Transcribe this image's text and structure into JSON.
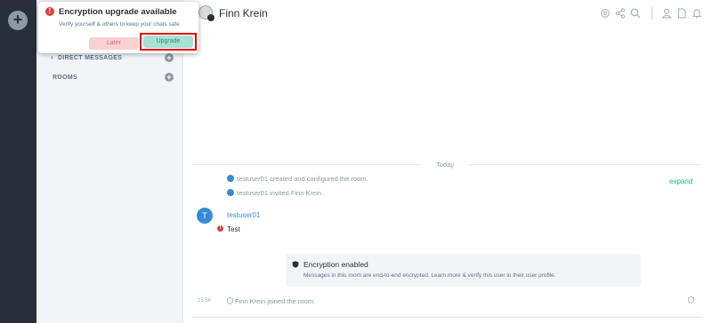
{
  "rail": {
    "add_glyph": "+"
  },
  "roomlist": {
    "sections": [
      {
        "label": "DIRECT MESSAGES",
        "has_chevron": true
      },
      {
        "label": "ROOMS",
        "has_chevron": false
      }
    ]
  },
  "toast": {
    "title": "Encryption upgrade available",
    "description": "Verify yourself & others to keep your chats safe",
    "later_label": "Later",
    "upgrade_label": "Upgrade"
  },
  "header": {
    "room_name": "Finn Krein",
    "icons": [
      "settings-icon",
      "share-icon",
      "search-icon",
      "person-icon",
      "files-icon",
      "bell-icon"
    ]
  },
  "timeline": {
    "date_label": "Today",
    "events": [
      "testuser01 created and configured the room.",
      "testuser01 invited Finn Krein."
    ],
    "expand_label": "expand",
    "message": {
      "avatar_letter": "T",
      "sender": "testuser01",
      "body": "Test"
    },
    "encryption": {
      "title": "Encryption enabled",
      "description": "Messages in this room are end-to-end encrypted. Learn more & verify this user in their user profile."
    },
    "join": {
      "timestamp": "15:56",
      "text": "Finn Krein joined the room."
    }
  },
  "colors": {
    "accent": "#0dbd8b",
    "link_blue": "#368bd6",
    "warning_red": "#e03e3e",
    "highlight_box": "#e60000"
  }
}
